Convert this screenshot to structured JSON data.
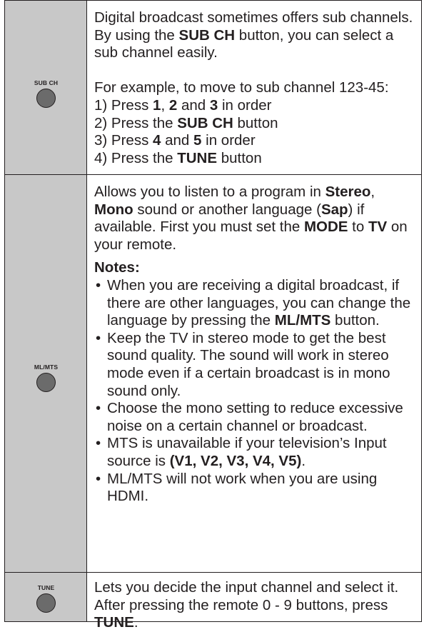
{
  "rows": [
    {
      "button_label": "SUB CH",
      "intro": {
        "t1": "Digital broadcast sometimes offers sub channels.  By using the ",
        "b1": "SUB CH",
        "t2": " button, you can select a sub channel easily."
      },
      "example": "For example, to move to sub channel 123-45:",
      "steps": [
        {
          "t1": "1) Press ",
          "b1": "1",
          "t2": ", ",
          "b2": "2",
          "t3": " and ",
          "b3": "3",
          "t4": " in order"
        },
        {
          "t1": "2) Press the ",
          "b1": "SUB CH",
          "t2": " button"
        },
        {
          "t1": "3) Press ",
          "b1": "4",
          "t2": " and ",
          "b2": "5",
          "t3": " in order"
        },
        {
          "t1": "4) Press the ",
          "b1": "TUNE",
          "t2": " button"
        }
      ]
    },
    {
      "button_label": "ML/MTS",
      "intro": {
        "t1": "Allows you to listen to a program in ",
        "b1": "Stereo",
        "t2": ", ",
        "b2": "Mono",
        "t3": " sound or another language (",
        "b3": "Sap",
        "t4": ") if available.  First you must set the ",
        "b4": "MODE",
        "t5": " to ",
        "b5": "TV",
        "t6": " on your remote."
      },
      "notes_heading": "Notes:",
      "notes": [
        {
          "t1": "When you are receiving a digital broadcast, if there are other languages, you can change the language by pressing the ",
          "b1": "ML/MTS",
          "t2": " button."
        },
        {
          "t1": "Keep the TV in stereo mode to get the best sound quality. The sound will work in stereo mode even if a certain broadcast is in mono sound only."
        },
        {
          "t1": "Choose the mono setting to reduce excessive noise on a certain channel or broadcast."
        },
        {
          "t1": "MTS is unavailable if your television’s Input source is ",
          "b1": "(V1, V2, V3, V4, V5)",
          "t2": "."
        },
        {
          "t1": "ML/MTS will not work when you are using HDMI."
        }
      ]
    },
    {
      "button_label": "TUNE",
      "intro": {
        "t1": "Lets you decide the input channel and select it. After pressing the remote 0 - 9 buttons, press ",
        "b1": "TUNE",
        "t2": "."
      }
    }
  ]
}
